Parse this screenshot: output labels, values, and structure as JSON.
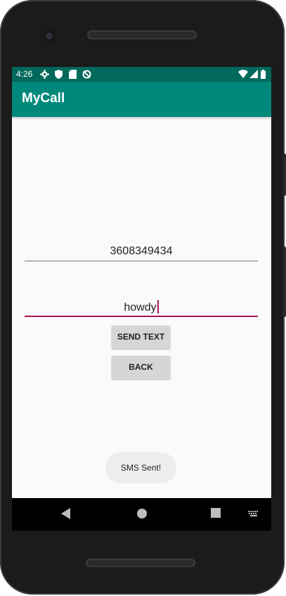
{
  "status_bar": {
    "time": "4:26",
    "left_icons": [
      "settings-icon",
      "shield-icon",
      "sd-card-icon",
      "sync-disabled-icon"
    ],
    "right_icons": [
      "wifi-icon",
      "signal-icon",
      "battery-icon"
    ]
  },
  "app_bar": {
    "title": "MyCall",
    "color": "#00897b",
    "status_color": "#00695c"
  },
  "form": {
    "phone_value": "3608349434",
    "message_value": "howdy",
    "accent_color": "#ad1457"
  },
  "buttons": {
    "send_label": "SEND TEXT",
    "back_label": "BACK"
  },
  "toast": {
    "message": "SMS Sent!"
  },
  "nav_bar": {
    "icons": [
      "back-icon",
      "home-icon",
      "recents-icon",
      "keyboard-icon"
    ]
  }
}
